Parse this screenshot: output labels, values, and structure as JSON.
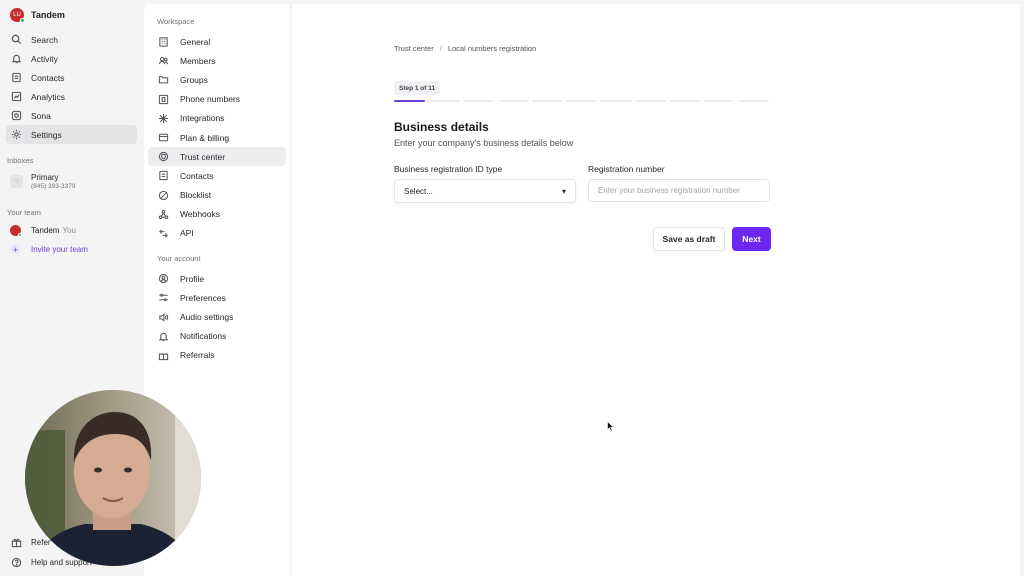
{
  "app": {
    "brand_name": "Tandem",
    "brand_initials": "LU",
    "accent": "#6d28f0"
  },
  "left_nav": {
    "items": [
      {
        "label": "Search",
        "icon": "search-icon"
      },
      {
        "label": "Activity",
        "icon": "bell-icon"
      },
      {
        "label": "Contacts",
        "icon": "contacts-icon"
      },
      {
        "label": "Analytics",
        "icon": "chart-icon"
      },
      {
        "label": "Sona",
        "icon": "sona-icon"
      },
      {
        "label": "Settings",
        "icon": "gear-icon",
        "active": true
      }
    ],
    "inboxes_label": "Inboxes",
    "inbox": {
      "name": "Primary",
      "number": "(845) 393-3379"
    },
    "team_label": "Your team",
    "team_member": {
      "name": "Tandem",
      "suffix": "You"
    },
    "invite_label": "Invite your team",
    "bottom": [
      {
        "label": "Refer",
        "icon": "gift-icon"
      },
      {
        "label": "Help and support",
        "icon": "help-icon"
      }
    ]
  },
  "settings_nav": {
    "workspace_label": "Workspace",
    "workspace_items": [
      {
        "label": "General",
        "icon": "building-icon"
      },
      {
        "label": "Members",
        "icon": "members-icon"
      },
      {
        "label": "Groups",
        "icon": "folder-icon"
      },
      {
        "label": "Phone numbers",
        "icon": "hash-icon"
      },
      {
        "label": "Integrations",
        "icon": "integrations-icon"
      },
      {
        "label": "Plan & billing",
        "icon": "card-icon"
      },
      {
        "label": "Trust center",
        "icon": "shield-icon",
        "active": true
      },
      {
        "label": "Contacts",
        "icon": "contacts-icon"
      },
      {
        "label": "Blocklist",
        "icon": "block-icon"
      },
      {
        "label": "Webhooks",
        "icon": "webhook-icon"
      },
      {
        "label": "API",
        "icon": "api-icon"
      }
    ],
    "account_label": "Your account",
    "account_items": [
      {
        "label": "Profile",
        "icon": "profile-icon"
      },
      {
        "label": "Preferences",
        "icon": "sliders-icon"
      },
      {
        "label": "Audio settings",
        "icon": "speaker-icon"
      },
      {
        "label": "Notifications",
        "icon": "bell-icon"
      },
      {
        "label": "Referrals",
        "icon": "gift-icon"
      }
    ]
  },
  "main": {
    "breadcrumb": {
      "parent": "Trust center",
      "separator": "/",
      "current": "Local numbers registration"
    },
    "step": {
      "label": "Step 1 of 11",
      "current": 1,
      "total": 11
    },
    "title": "Business details",
    "subtitle": "Enter your company's business details below",
    "form": {
      "id_type_label": "Business registration ID type",
      "id_type_value": "Select...",
      "reg_number_label": "Registration number",
      "reg_number_placeholder": "Enter your business registration number",
      "reg_number_value": ""
    },
    "buttons": {
      "draft": "Save as draft",
      "next": "Next"
    }
  }
}
